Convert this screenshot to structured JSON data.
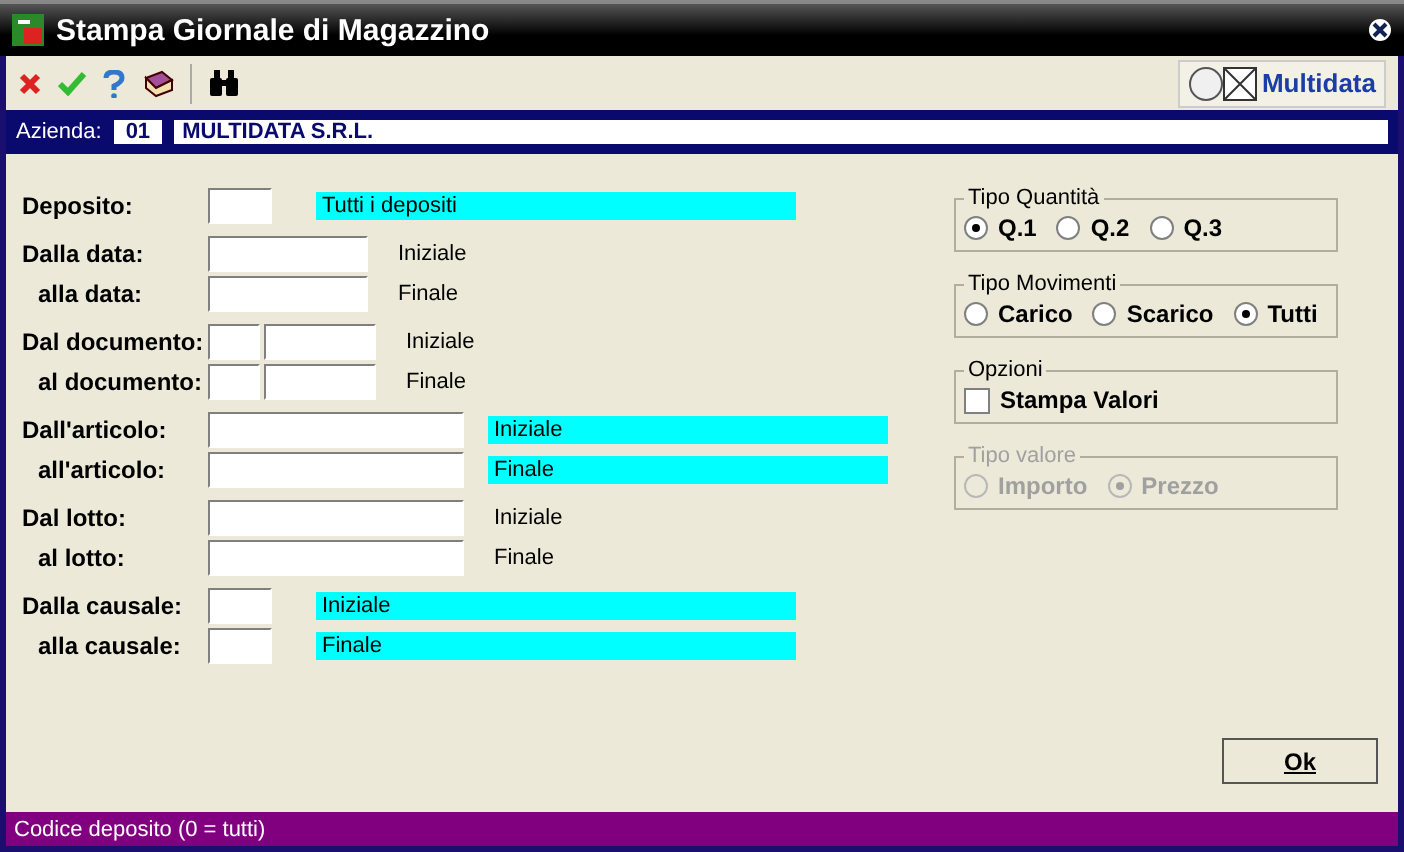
{
  "window": {
    "title": "Stampa Giornale di Magazzino"
  },
  "toolbar": {
    "brand": "Multidata"
  },
  "company": {
    "label": "Azienda:",
    "code": "01",
    "name": "MULTIDATA S.R.L."
  },
  "form": {
    "groups": [
      {
        "rows": [
          {
            "label": "Deposito:",
            "kind": "code",
            "note": "Tutti i depositi",
            "highlighted": true
          }
        ]
      },
      {
        "rows": [
          {
            "label": "Dalla data:",
            "kind": "date",
            "note": "Iniziale",
            "highlighted": false
          },
          {
            "label": "alla data:",
            "kind": "date",
            "note": "Finale",
            "highlighted": false
          }
        ]
      },
      {
        "rows": [
          {
            "label": "Dal documento:",
            "kind": "document",
            "note": "Iniziale",
            "highlighted": false
          },
          {
            "label": "al documento:",
            "kind": "document",
            "note": "Finale",
            "highlighted": false
          }
        ]
      },
      {
        "rows": [
          {
            "label": "Dall'articolo:",
            "kind": "long",
            "note": "Iniziale",
            "highlighted": true
          },
          {
            "label": "all'articolo:",
            "kind": "long",
            "note": "Finale",
            "highlighted": true
          }
        ]
      },
      {
        "rows": [
          {
            "label": "Dal lotto:",
            "kind": "long",
            "note": "Iniziale",
            "highlighted": false
          },
          {
            "label": "al lotto:",
            "kind": "long",
            "note": "Finale",
            "highlighted": false
          }
        ]
      },
      {
        "rows": [
          {
            "label": "Dalla causale:",
            "kind": "code",
            "note": "Iniziale",
            "highlighted": true
          },
          {
            "label": "alla causale:",
            "kind": "code",
            "note": "Finale",
            "highlighted": true
          }
        ]
      }
    ]
  },
  "options": [
    {
      "title": "Tipo Quantità",
      "kind": "radio",
      "disabled": false,
      "items": [
        {
          "label": "Q.1",
          "selected": true
        },
        {
          "label": "Q.2",
          "selected": false
        },
        {
          "label": "Q.3",
          "selected": false
        }
      ]
    },
    {
      "title": "Tipo Movimenti",
      "kind": "radio",
      "disabled": false,
      "items": [
        {
          "label": "Carico",
          "selected": false
        },
        {
          "label": "Scarico",
          "selected": false
        },
        {
          "label": "Tutti",
          "selected": true
        }
      ]
    },
    {
      "title": "Opzioni",
      "kind": "checkbox",
      "disabled": false,
      "items": [
        {
          "label": "Stampa Valori",
          "checked": false
        }
      ]
    },
    {
      "title": "Tipo valore",
      "kind": "radio",
      "disabled": true,
      "items": [
        {
          "label": "Importo",
          "selected": false
        },
        {
          "label": "Prezzo",
          "selected": true
        }
      ]
    }
  ],
  "buttons": [
    {
      "label": "Ok"
    }
  ],
  "status_bar": "Codice deposito (0 = tutti)"
}
